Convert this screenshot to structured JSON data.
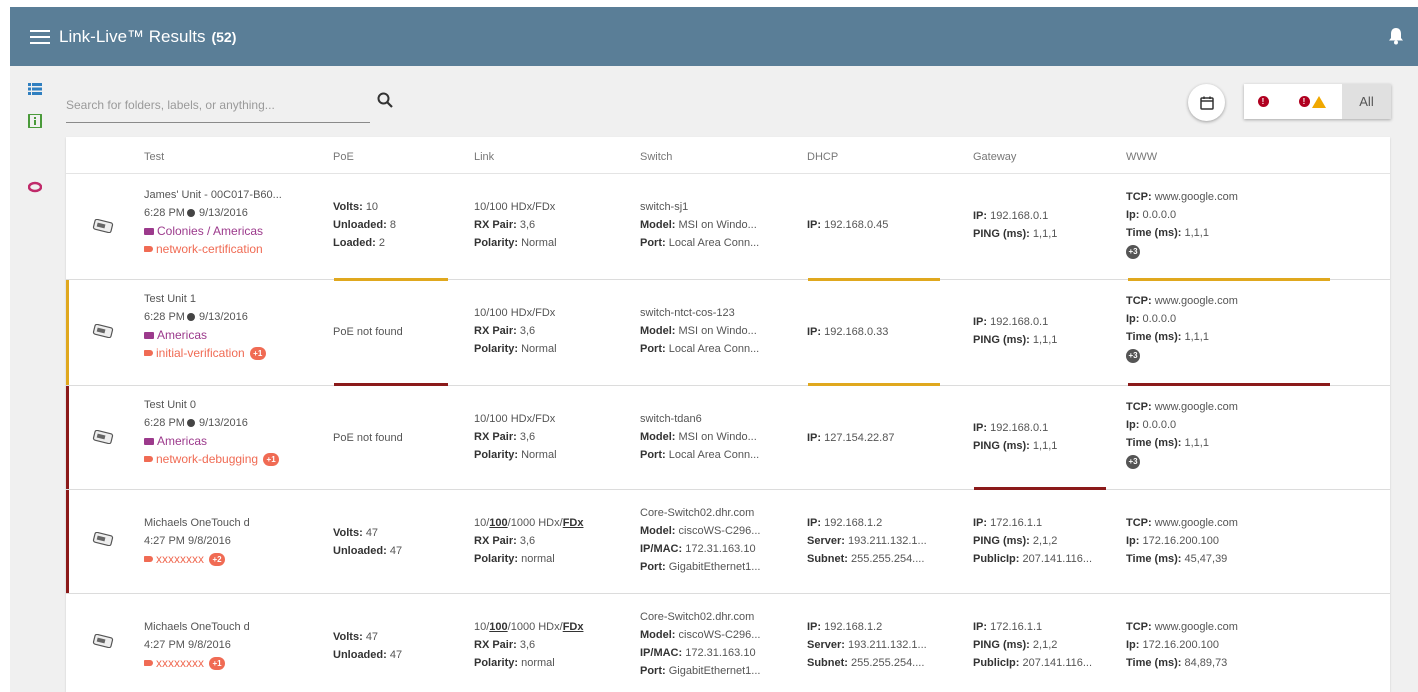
{
  "header": {
    "title": "Link-Live™ Results",
    "count": "(52)"
  },
  "search": {
    "placeholder": "Search for folders, labels, or anything..."
  },
  "filters": {
    "all_label": "All"
  },
  "colors": {
    "header": "#5a7e97",
    "error": "#8b1a1a",
    "warning": "#e0a81e",
    "folder": "#9c3a8c",
    "tag": "#f06b54"
  },
  "columns": [
    "Test",
    "PoE",
    "Link",
    "Switch",
    "DHCP",
    "Gateway",
    "WWW"
  ],
  "rows": [
    {
      "name": "James' Unit - 00C017-B60...",
      "time": "6:28 PM",
      "date": "9/13/2016",
      "folder": "Colonies / Americas",
      "tag": "network-certification",
      "poe": [
        [
          "Volts:",
          "10"
        ],
        [
          "Unloaded:",
          "8"
        ],
        [
          "Loaded:",
          "2"
        ]
      ],
      "link": [
        "10/100 HDx/FDx",
        [
          "RX Pair:",
          "3,6"
        ],
        [
          "Polarity:",
          "Normal"
        ]
      ],
      "switch": [
        "switch-sj1",
        [
          "Model:",
          "MSI on Windo..."
        ],
        [
          "Port:",
          "Local Area Conn..."
        ]
      ],
      "dhcp": [
        [
          "IP:",
          "192.168.0.45"
        ]
      ],
      "gateway": [
        [
          "IP:",
          "192.168.0.1"
        ],
        [
          "PING (ms):",
          "1,1,1"
        ]
      ],
      "www": [
        [
          "TCP:",
          "www.google.com"
        ],
        [
          "Ip:",
          "0.0.0.0"
        ],
        [
          "Time (ms):",
          "1,1,1"
        ]
      ],
      "www_more": "+3"
    },
    {
      "name": "Test Unit 1",
      "time": "6:28 PM",
      "date": "9/13/2016",
      "folder": "Americas",
      "tag": "initial-verification",
      "tag_badge": "+1",
      "poe_text": "PoE not found",
      "link": [
        "10/100 HDx/FDx",
        [
          "RX Pair:",
          "3,6"
        ],
        [
          "Polarity:",
          "Normal"
        ]
      ],
      "switch": [
        "switch-ntct-cos-123",
        [
          "Model:",
          "MSI on Windo..."
        ],
        [
          "Port:",
          "Local Area Conn..."
        ]
      ],
      "dhcp": [
        [
          "IP:",
          "192.168.0.33"
        ]
      ],
      "gateway": [
        [
          "IP:",
          "192.168.0.1"
        ],
        [
          "PING (ms):",
          "1,1,1"
        ]
      ],
      "www": [
        [
          "TCP:",
          "www.google.com"
        ],
        [
          "Ip:",
          "0.0.0.0"
        ],
        [
          "Time (ms):",
          "1,1,1"
        ]
      ],
      "www_more": "+3"
    },
    {
      "name": "Test Unit 0",
      "time": "6:28 PM",
      "date": "9/13/2016",
      "folder": "Americas",
      "tag": "network-debugging",
      "tag_badge": "+1",
      "poe_text": "PoE not found",
      "link": [
        "10/100 HDx/FDx",
        [
          "RX Pair:",
          "3,6"
        ],
        [
          "Polarity:",
          "Normal"
        ]
      ],
      "switch": [
        "switch-tdan6",
        [
          "Model:",
          "MSI on Windo..."
        ],
        [
          "Port:",
          "Local Area Conn..."
        ]
      ],
      "dhcp": [
        [
          "IP:",
          "127.154.22.87"
        ]
      ],
      "gateway": [
        [
          "IP:",
          "192.168.0.1"
        ],
        [
          "PING (ms):",
          "1,1,1"
        ]
      ],
      "www": [
        [
          "TCP:",
          "www.google.com"
        ],
        [
          "Ip:",
          "0.0.0.0"
        ],
        [
          "Time (ms):",
          "1,1,1"
        ]
      ],
      "www_more": "+3"
    },
    {
      "name": "Michaels OneTouch d",
      "time": "4:27 PM",
      "date": "9/8/2016",
      "tag": "xxxxxxxx",
      "tag_badge": "+2",
      "poe": [
        [
          "Volts:",
          "47"
        ],
        [
          "Unloaded:",
          "47"
        ]
      ],
      "link_speed": [
        "10/",
        "100",
        "/1000 HDx/",
        "FDx"
      ],
      "link": [
        [
          "RX Pair:",
          "3,6"
        ],
        [
          "Polarity:",
          "normal"
        ]
      ],
      "switch": [
        "Core-Switch02.dhr.com",
        [
          "Model:",
          "ciscoWS-C296..."
        ],
        [
          "IP/MAC:",
          "172.31.163.10"
        ],
        [
          "Port:",
          "GigabitEthernet1..."
        ]
      ],
      "dhcp": [
        [
          "IP:",
          "192.168.1.2"
        ],
        [
          "Server:",
          "193.211.132.1..."
        ],
        [
          "Subnet:",
          "255.255.254...."
        ]
      ],
      "gateway": [
        [
          "IP:",
          "172.16.1.1"
        ],
        [
          "PING (ms):",
          "2,1,2"
        ],
        [
          "PublicIp:",
          "207.141.116..."
        ]
      ],
      "www": [
        [
          "TCP:",
          "www.google.com"
        ],
        [
          "Ip:",
          "172.16.200.100"
        ],
        [
          "Time (ms):",
          "45,47,39"
        ]
      ]
    },
    {
      "name": "Michaels OneTouch d",
      "time": "4:27 PM",
      "date": "9/8/2016",
      "tag": "xxxxxxxx",
      "tag_badge": "+1",
      "poe": [
        [
          "Volts:",
          "47"
        ],
        [
          "Unloaded:",
          "47"
        ]
      ],
      "link_speed": [
        "10/",
        "100",
        "/1000 HDx/",
        "FDx"
      ],
      "link": [
        [
          "RX Pair:",
          "3,6"
        ],
        [
          "Polarity:",
          "normal"
        ]
      ],
      "switch": [
        "Core-Switch02.dhr.com",
        [
          "Model:",
          "ciscoWS-C296..."
        ],
        [
          "IP/MAC:",
          "172.31.163.10"
        ],
        [
          "Port:",
          "GigabitEthernet1..."
        ]
      ],
      "dhcp": [
        [
          "IP:",
          "192.168.1.2"
        ],
        [
          "Server:",
          "193.211.132.1..."
        ],
        [
          "Subnet:",
          "255.255.254...."
        ]
      ],
      "gateway": [
        [
          "IP:",
          "172.16.1.1"
        ],
        [
          "PING (ms):",
          "2,1,2"
        ],
        [
          "PublicIp:",
          "207.141.116..."
        ]
      ],
      "www": [
        [
          "TCP:",
          "www.google.com"
        ],
        [
          "Ip:",
          "172.16.200.100"
        ],
        [
          "Time (ms):",
          "84,89,73"
        ]
      ]
    }
  ]
}
